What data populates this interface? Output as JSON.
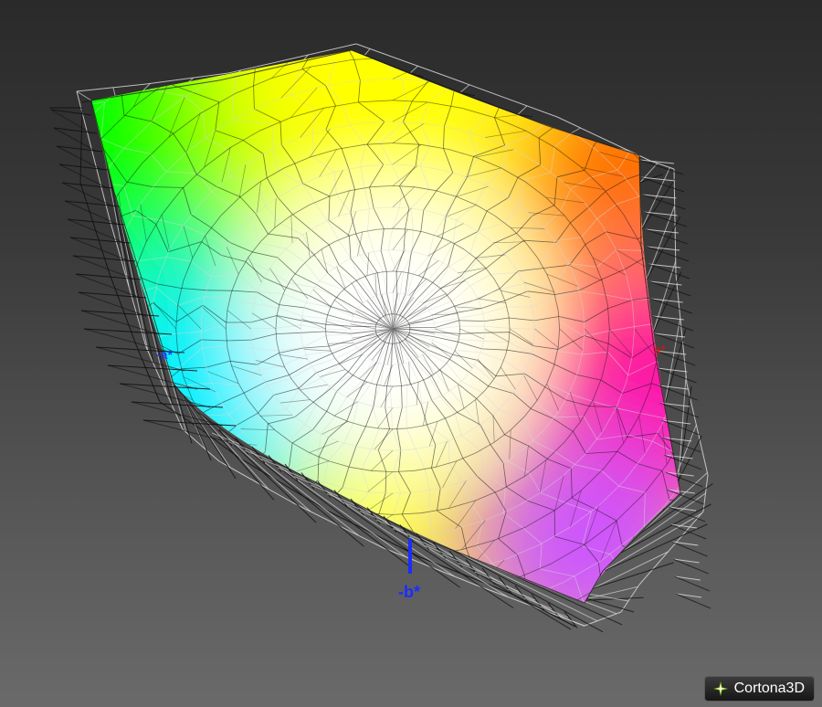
{
  "scene": {
    "axis_labels": {
      "neg_b": "-b*",
      "neg_a": "-a*",
      "pos_a": "a*"
    },
    "axis_colors": {
      "b": "#1a2cff",
      "a": "#e01010"
    },
    "mesh_colors": {
      "outer_wire": "#d8d8d8",
      "inner_wire": "#111111"
    },
    "gamut_colors": [
      "#00ff00",
      "#ffff00",
      "#ff6a00",
      "#ff00a0",
      "#cc55ff",
      "#00f0ff",
      "#ffffff"
    ]
  },
  "logo": {
    "text": "Cortona3D",
    "icon": "cortona-star-icon"
  }
}
